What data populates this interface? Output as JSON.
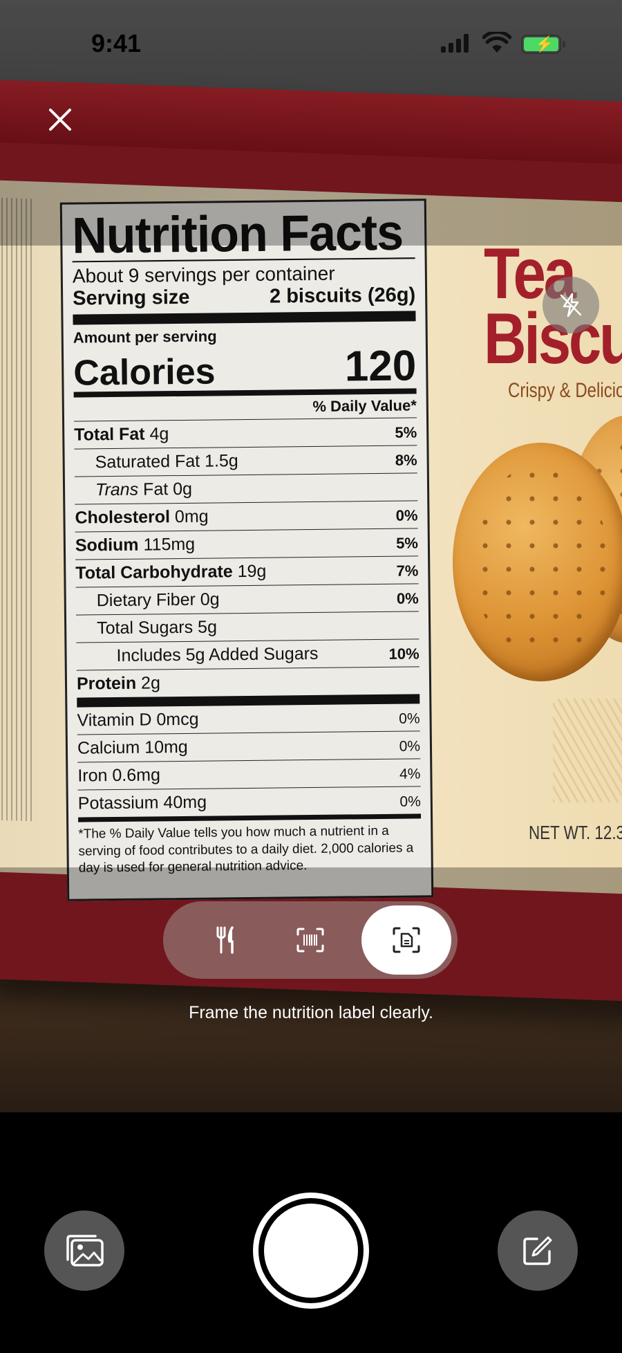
{
  "status_bar": {
    "time": "9:41"
  },
  "nutrition_label": {
    "title": "Nutrition Facts",
    "servings": "About 9 servings per container",
    "serving_size_label": "Serving size",
    "serving_size_value": "2 biscuits (26g)",
    "amount_per_serving": "Amount per serving",
    "calories_label": "Calories",
    "calories_value": "120",
    "dv_header": "% Daily Value*",
    "nutrients": [
      {
        "name": "Total Fat",
        "amount": "4g",
        "pct": "5%"
      },
      {
        "name": "Saturated Fat",
        "amount": "1.5g",
        "pct": "8%"
      },
      {
        "name": "Trans",
        "amount": "Fat 0g",
        "pct": ""
      },
      {
        "name": "Cholesterol",
        "amount": "0mg",
        "pct": "0%"
      },
      {
        "name": "Sodium",
        "amount": "115mg",
        "pct": "5%"
      },
      {
        "name": "Total Carbohydrate",
        "amount": "19g",
        "pct": "7%"
      },
      {
        "name": "Dietary Fiber",
        "amount": "0g",
        "pct": "0%"
      },
      {
        "name": "Total Sugars",
        "amount": "5g",
        "pct": ""
      },
      {
        "name": "Includes 5g Added Sugars",
        "amount": "",
        "pct": "10%"
      },
      {
        "name": "Protein",
        "amount": "2g",
        "pct": ""
      }
    ],
    "vitamins": [
      {
        "name": "Vitamin D 0mcg",
        "pct": "0%"
      },
      {
        "name": "Calcium 10mg",
        "pct": "0%"
      },
      {
        "name": "Iron 0.6mg",
        "pct": "4%"
      },
      {
        "name": "Potassium 40mg",
        "pct": "0%"
      }
    ],
    "footnote": "*The % Daily Value tells you how much a nutrient in a serving of food contributes to a daily diet. 2,000 calories a day is used for general nutrition advice."
  },
  "product": {
    "brand_line1": "Tea",
    "brand_line2": "Biscuit",
    "tagline": "Crispy & Delicio",
    "net_weight": "NET WT. 12.3"
  },
  "icons": {
    "close": "close-icon",
    "flash": "flash-off-icon",
    "food": "fork-knife-icon",
    "barcode": "barcode-scan-icon",
    "label": "document-scan-icon",
    "gallery": "photo-gallery-icon",
    "edit": "edit-icon"
  },
  "scanner": {
    "selected_mode": "label",
    "hint": "Frame the nutrition label clearly."
  },
  "colors": {
    "package_red": "#a3202a",
    "battery_green": "#4cd964",
    "active_mode_bg": "#ffffff"
  }
}
